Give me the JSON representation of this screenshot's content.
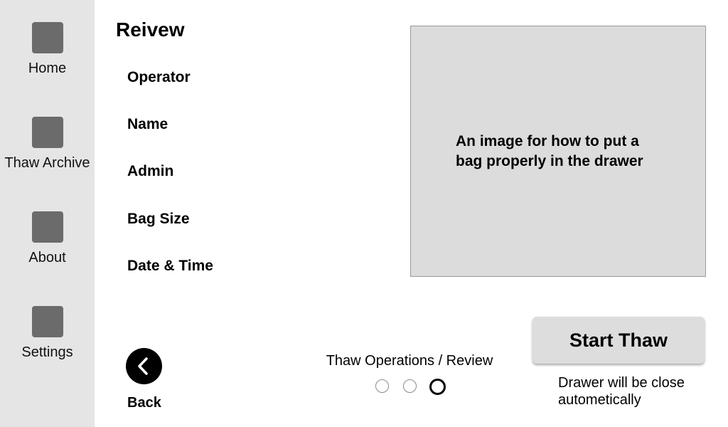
{
  "sidebar": {
    "items": [
      {
        "label": "Home",
        "icon": "home-icon"
      },
      {
        "label": "Thaw Archive",
        "icon": "archive-icon"
      },
      {
        "label": "About",
        "icon": "info-icon"
      },
      {
        "label": "Settings",
        "icon": "settings-icon"
      }
    ]
  },
  "page": {
    "title": "Reivew"
  },
  "fields": [
    {
      "label": "Operator"
    },
    {
      "label": "Name"
    },
    {
      "label": "Admin"
    },
    {
      "label": "Bag Size"
    },
    {
      "label": "Date & Time"
    }
  ],
  "image_placeholder": {
    "text": "An image for how to put a bag properly in the drawer"
  },
  "navigation": {
    "back_label": "Back"
  },
  "steps": {
    "caption": "Thaw Operations / Review",
    "total": 3,
    "current": 3
  },
  "action": {
    "start_label": "Start Thaw",
    "note": "Drawer will be close autometically"
  },
  "colors": {
    "sidebar_bg": "#e5e5e5",
    "icon_placeholder": "#6b6b6b",
    "image_bg": "#dcdcdc",
    "button_bg": "#dddddd"
  }
}
